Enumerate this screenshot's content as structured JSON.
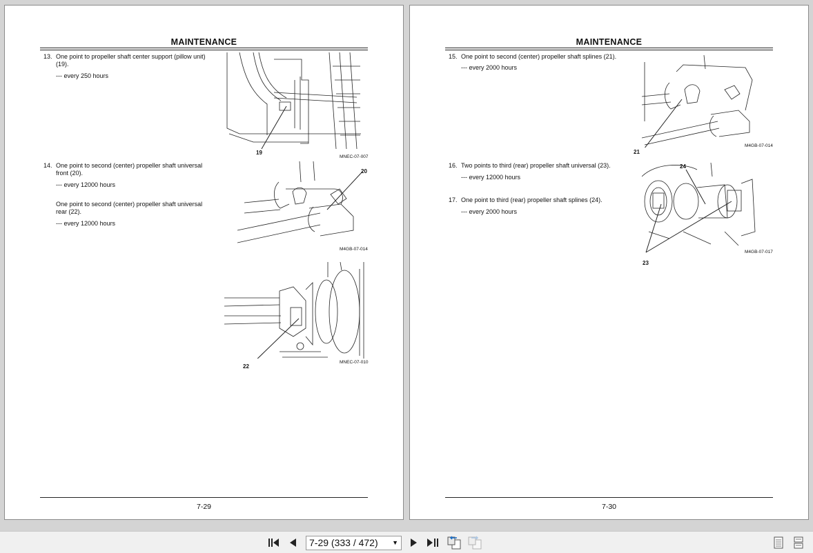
{
  "left_page": {
    "header": "MAINTENANCE",
    "page_number": "7-29",
    "items": [
      {
        "num": "13.",
        "text": "One point to propeller shaft center support (pillow unit) (19).",
        "interval": "--- every 250 hours"
      },
      {
        "num": "14.",
        "text": "One point to second (center) propeller shaft universal front (20).",
        "interval": "--- every 12000 hours"
      },
      {
        "num": "",
        "text": "One point to second (center) propeller shaft universal rear (22).",
        "interval": "--- every 12000 hours"
      }
    ],
    "figures": [
      {
        "id": "MNEC-07-007",
        "callouts": [
          "19"
        ]
      },
      {
        "id": "M4GB-07-014",
        "callouts": [
          "20"
        ]
      },
      {
        "id": "MNEC-07-010",
        "callouts": [
          "22"
        ]
      }
    ]
  },
  "right_page": {
    "header": "MAINTENANCE",
    "page_number": "7-30",
    "items": [
      {
        "num": "15.",
        "text": "One point to second (center) propeller shaft splines (21).",
        "interval": "--- every 2000 hours"
      },
      {
        "num": "16.",
        "text": "Two points to third (rear) propeller shaft universal (23).",
        "interval": "--- every 12000 hours"
      },
      {
        "num": "17.",
        "text": "One point to third (rear) propeller shaft splines (24).",
        "interval": "--- every 2000 hours"
      }
    ],
    "figures": [
      {
        "id": "M4GB-07-014",
        "callouts": [
          "21"
        ]
      },
      {
        "id": "M4GB-07-017",
        "callouts": [
          "24",
          "23"
        ]
      }
    ]
  },
  "toolbar": {
    "page_field_value": "7-29 (333 / 472)",
    "icons": [
      "first-page-icon",
      "previous-page-icon",
      "next-page-icon",
      "last-page-icon",
      "previous-view-icon",
      "next-view-icon",
      "single-page-view-icon",
      "continuous-view-icon"
    ]
  }
}
